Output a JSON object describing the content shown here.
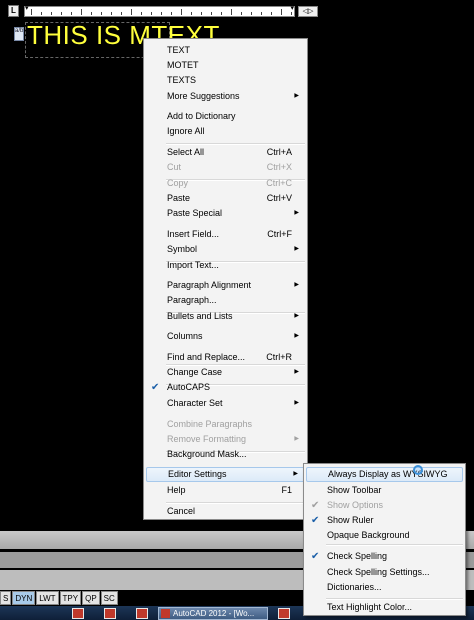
{
  "editor": {
    "ruler_label": "L",
    "ruler_button": "◁▷",
    "stack_button": "a/b",
    "mtext_content": "THIS IS MTEXT"
  },
  "context_menu": {
    "items": [
      {
        "label": "TEXT"
      },
      {
        "label": "MOTET"
      },
      {
        "label": "TEXTS"
      },
      {
        "label": "More Suggestions",
        "submenu": true
      },
      {
        "label": "Add to Dictionary"
      },
      {
        "label": "Ignore All"
      },
      {
        "label": "Select All",
        "shortcut": "Ctrl+A"
      },
      {
        "label": "Cut",
        "shortcut": "Ctrl+X",
        "disabled": true
      },
      {
        "label": "Copy",
        "shortcut": "Ctrl+C",
        "disabled": true
      },
      {
        "label": "Paste",
        "shortcut": "Ctrl+V"
      },
      {
        "label": "Paste Special",
        "submenu": true
      },
      {
        "label": "Insert Field...",
        "shortcut": "Ctrl+F"
      },
      {
        "label": "Symbol",
        "submenu": true
      },
      {
        "label": "Import Text..."
      },
      {
        "label": "Paragraph Alignment",
        "submenu": true
      },
      {
        "label": "Paragraph..."
      },
      {
        "label": "Bullets and Lists",
        "submenu": true
      },
      {
        "label": "Columns",
        "submenu": true
      },
      {
        "label": "Find and Replace...",
        "shortcut": "Ctrl+R"
      },
      {
        "label": "Change Case",
        "submenu": true
      },
      {
        "label": "AutoCAPS",
        "checked": true
      },
      {
        "label": "Character Set",
        "submenu": true
      },
      {
        "label": "Combine Paragraphs",
        "disabled": true
      },
      {
        "label": "Remove Formatting",
        "submenu": true,
        "disabled": true
      },
      {
        "label": "Background Mask..."
      },
      {
        "label": "Editor Settings",
        "submenu": true,
        "highlighted": true
      },
      {
        "label": "Help",
        "shortcut": "F1"
      },
      {
        "label": "Cancel"
      }
    ]
  },
  "editor_settings_menu": {
    "items": [
      {
        "label": "Always Display as WYSIWYG",
        "highlighted": true
      },
      {
        "label": "Show Toolbar"
      },
      {
        "label": "Show Options",
        "checked": true,
        "disabled": true
      },
      {
        "label": "Show Ruler",
        "checked": true
      },
      {
        "label": "Opaque Background"
      },
      {
        "label": "Check Spelling",
        "checked": true
      },
      {
        "label": "Check Spelling Settings..."
      },
      {
        "label": "Dictionaries..."
      },
      {
        "label": "Text Highlight Color..."
      }
    ]
  },
  "status_bar": {
    "tabs": [
      "S",
      "DYN",
      "LWT",
      "TPY",
      "QP",
      "SC"
    ],
    "active_tab": "DYN"
  },
  "taskbar": {
    "app_label": "AutoCAD 2012 - [Wo..."
  },
  "colors": {
    "mtext": "#ffff3c",
    "background": "#000000",
    "menu": "#f3f3f3",
    "highlight": "#dceaf8"
  }
}
